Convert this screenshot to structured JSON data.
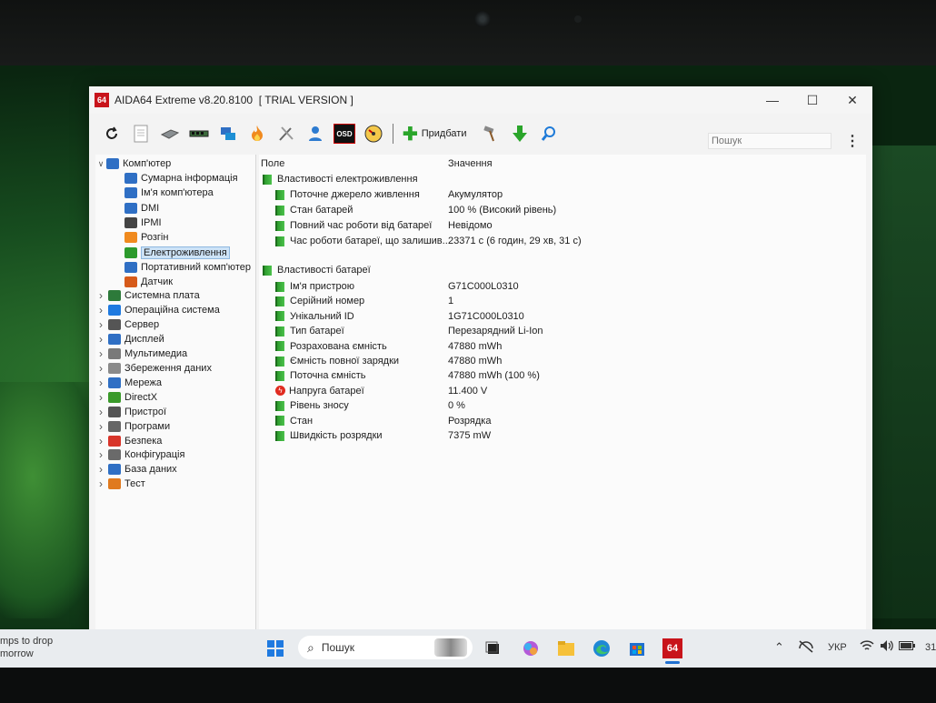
{
  "window": {
    "app_icon_text": "64",
    "title": "AIDA64 Extreme v8.20.8100  [ TRIAL VERSION ]",
    "minimize": "—",
    "maximize": "☐",
    "close": "✕"
  },
  "toolbar": {
    "add_label": "Придбати",
    "search_placeholder": "Пошук",
    "osd_label": "OSD",
    "icons": [
      "refresh-icon",
      "report-icon",
      "motherboard-icon",
      "memory-icon",
      "network-icon",
      "flame-icon",
      "tools-icon",
      "user-icon",
      "osd-icon",
      "gauge-icon",
      "add-icon",
      "hammer-icon",
      "download-icon",
      "search-icon"
    ]
  },
  "tree": {
    "root": "Комп'ютер",
    "children": [
      {
        "label": "Сумарна інформація",
        "icon": "computer-icon",
        "color": "#2f6fc4"
      },
      {
        "label": "Ім'я комп'ютера",
        "icon": "computer-icon",
        "color": "#2f6fc4"
      },
      {
        "label": "DMI",
        "icon": "computer-icon",
        "color": "#2f6fc4"
      },
      {
        "label": "IPMI",
        "icon": "ipmi-icon",
        "color": "#444444"
      },
      {
        "label": "Розгін",
        "icon": "flame-icon",
        "color": "#f08a1e"
      },
      {
        "label": "Електроживлення",
        "icon": "battery-icon",
        "color": "#2c9a2c",
        "selected": true
      },
      {
        "label": "Портативний комп'ютер",
        "icon": "laptop-icon",
        "color": "#2f6fc4"
      },
      {
        "label": "Датчик",
        "icon": "sensor-icon",
        "color": "#d65a1a"
      }
    ],
    "top_level": [
      {
        "label": "Системна плата",
        "icon": "motherboard-icon",
        "color": "#2d7a3a"
      },
      {
        "label": "Операційна система",
        "icon": "windows-icon",
        "color": "#1f7ae0"
      },
      {
        "label": "Сервер",
        "icon": "server-icon",
        "color": "#555555"
      },
      {
        "label": "Дисплей",
        "icon": "display-icon",
        "color": "#2f6fc4"
      },
      {
        "label": "Мультимедиа",
        "icon": "speaker-icon",
        "color": "#7a7a7a"
      },
      {
        "label": "Збереження даних",
        "icon": "storage-icon",
        "color": "#8a8a8a"
      },
      {
        "label": "Мережа",
        "icon": "network-icon",
        "color": "#2f6fc4"
      },
      {
        "label": "DirectX",
        "icon": "directx-icon",
        "color": "#3a9a2a"
      },
      {
        "label": "Пристрої",
        "icon": "devices-icon",
        "color": "#555555"
      },
      {
        "label": "Програми",
        "icon": "programs-icon",
        "color": "#666666"
      },
      {
        "label": "Безпека",
        "icon": "shield-icon",
        "color": "#d8352a"
      },
      {
        "label": "Конфігурація",
        "icon": "config-icon",
        "color": "#6a6a6a"
      },
      {
        "label": "База даних",
        "icon": "database-icon",
        "color": "#2f6fc4"
      },
      {
        "label": "Тест",
        "icon": "test-icon",
        "color": "#e07a1e"
      }
    ]
  },
  "content": {
    "col_field": "Поле",
    "col_value": "Значення",
    "section_power": "Властивості електроживлення",
    "power_rows": [
      {
        "field": "Поточне джерело живлення",
        "value": "Акумулятор"
      },
      {
        "field": "Стан батарей",
        "value": "100 % (Високий рівень)"
      },
      {
        "field": "Повний час роботи від батареї",
        "value": "Невідомо"
      },
      {
        "field": "Час роботи батареї, що залишив...",
        "value": "23371 с (6 годин, 29 хв, 31 с)"
      }
    ],
    "section_battery": "Властивості батареї",
    "battery_rows": [
      {
        "field": "Ім'я пристрою",
        "value": "G71C000L0310",
        "icon": "green"
      },
      {
        "field": "Серійний номер",
        "value": "1",
        "icon": "green"
      },
      {
        "field": "Унікальний ID",
        "value": "1G71C000L0310",
        "icon": "green"
      },
      {
        "field": "Тип батареї",
        "value": "Перезарядний Li-Ion",
        "icon": "green"
      },
      {
        "field": "Розрахована ємність",
        "value": "47880 mWh",
        "icon": "green"
      },
      {
        "field": "Ємність повної зарядки",
        "value": "47880 mWh",
        "icon": "green"
      },
      {
        "field": "Поточна ємність",
        "value": "47880 mWh  (100 %)",
        "icon": "green"
      },
      {
        "field": "Напруга батареї",
        "value": "11.400 V",
        "icon": "red"
      },
      {
        "field": "Рівень зносу",
        "value": "0 %",
        "icon": "green"
      },
      {
        "field": "Стан",
        "value": "Розрядка",
        "icon": "green"
      },
      {
        "field": "Швидкість розрядки",
        "value": "7375 mW",
        "icon": "green"
      }
    ]
  },
  "taskbar": {
    "widget_line1": "mps to drop",
    "widget_line2": "morrow",
    "search_label": "Пошук",
    "active_app": "64",
    "language": "УКР",
    "clock_fragment": "31"
  }
}
